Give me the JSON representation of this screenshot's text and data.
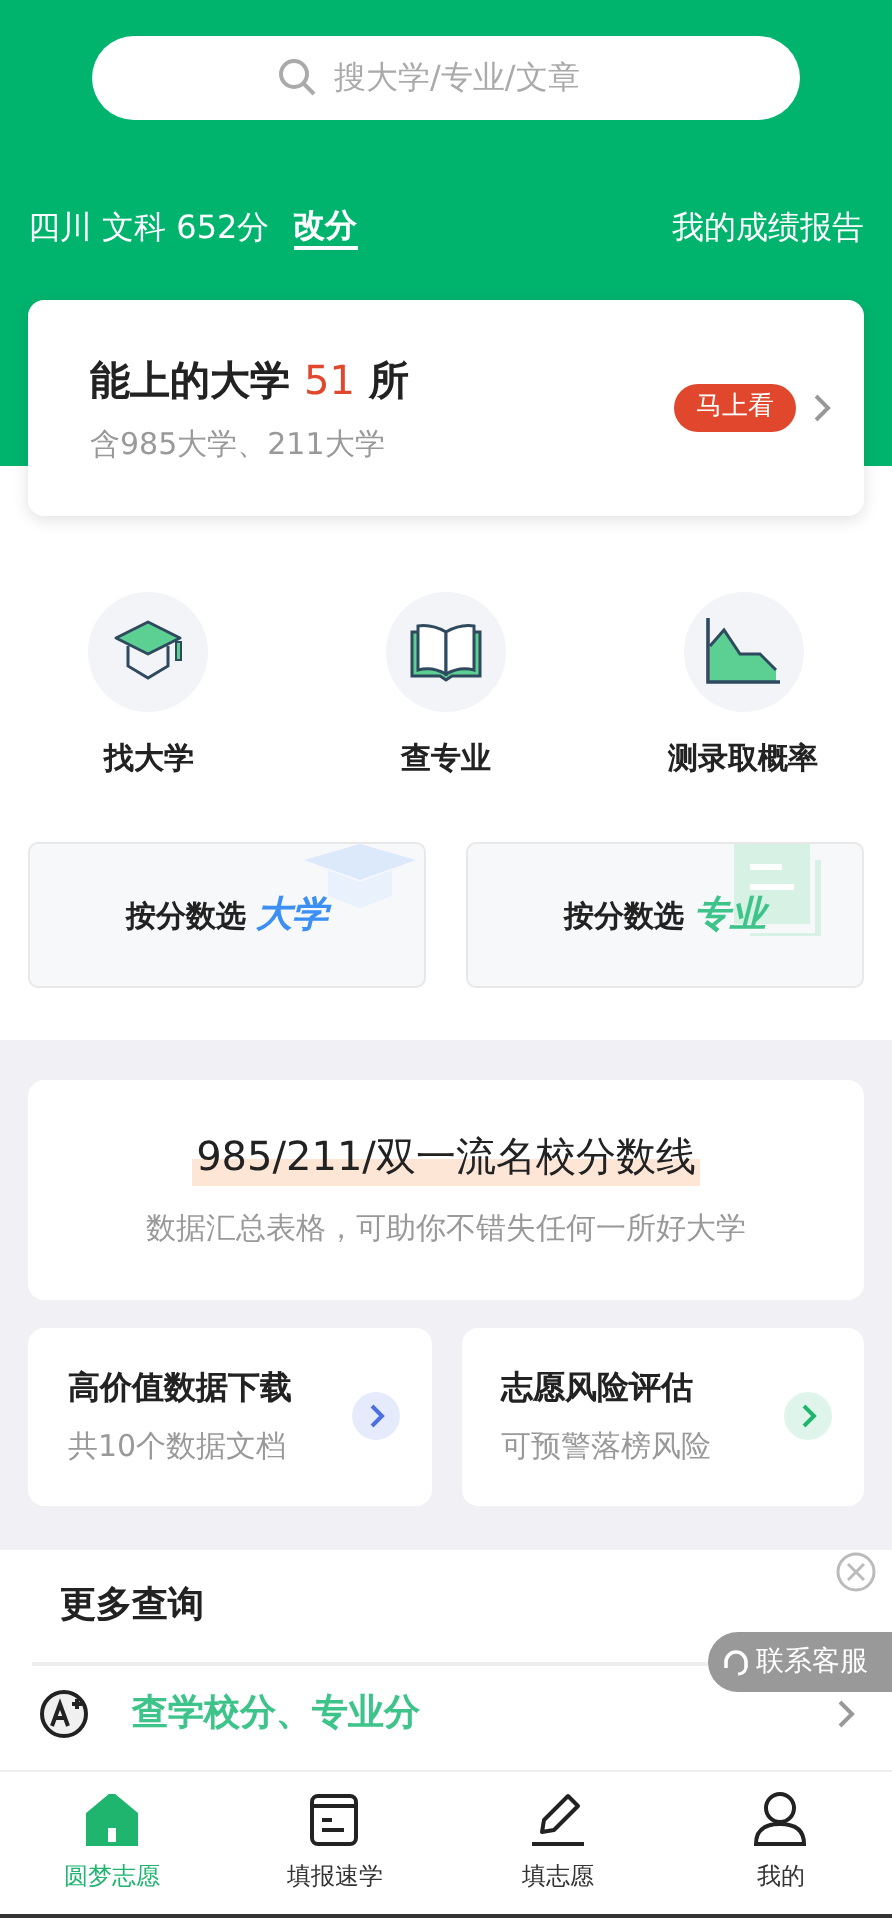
{
  "search": {
    "placeholder": "搜大学/专业/文章"
  },
  "score": {
    "info": "四川 文科 652分",
    "change": "改分",
    "report": "我的成绩报告"
  },
  "summary": {
    "prefix": "能上的大学",
    "count": "51",
    "suffix": "所",
    "sub": "含985大学、211大学",
    "badge": "马上看"
  },
  "quick": [
    {
      "kind": "cap",
      "label": "找大学"
    },
    {
      "kind": "book",
      "label": "查专业"
    },
    {
      "kind": "chart",
      "label": "测录取概率"
    }
  ],
  "filters": [
    {
      "kind": "school",
      "label": "按分数选",
      "highlight": "大学",
      "color": "#3b8ff5"
    },
    {
      "kind": "major",
      "label": "按分数选",
      "highlight": "专业",
      "color": "#3ec48a"
    }
  ],
  "banner": {
    "title": "985/211/双一流名校分数线",
    "sub": "数据汇总表格，可助你不错失任何一所好大学"
  },
  "cards": [
    {
      "title": "高价值数据下载",
      "sub": "共10个数据文档",
      "color": "#4a6fe0"
    },
    {
      "title": "志愿风险评估",
      "sub": "可预警落榜风险",
      "color": "#1fb56f"
    }
  ],
  "more": {
    "title": "更多查询",
    "row": "查学校分、专业分"
  },
  "service": "联系客服",
  "tabs": [
    {
      "kind": "home",
      "label": "圆梦志愿",
      "selected": true
    },
    {
      "kind": "calendar",
      "label": "填报速学",
      "selected": false
    },
    {
      "kind": "pen",
      "label": "填志愿",
      "selected": false
    },
    {
      "kind": "user",
      "label": "我的",
      "selected": false
    }
  ]
}
